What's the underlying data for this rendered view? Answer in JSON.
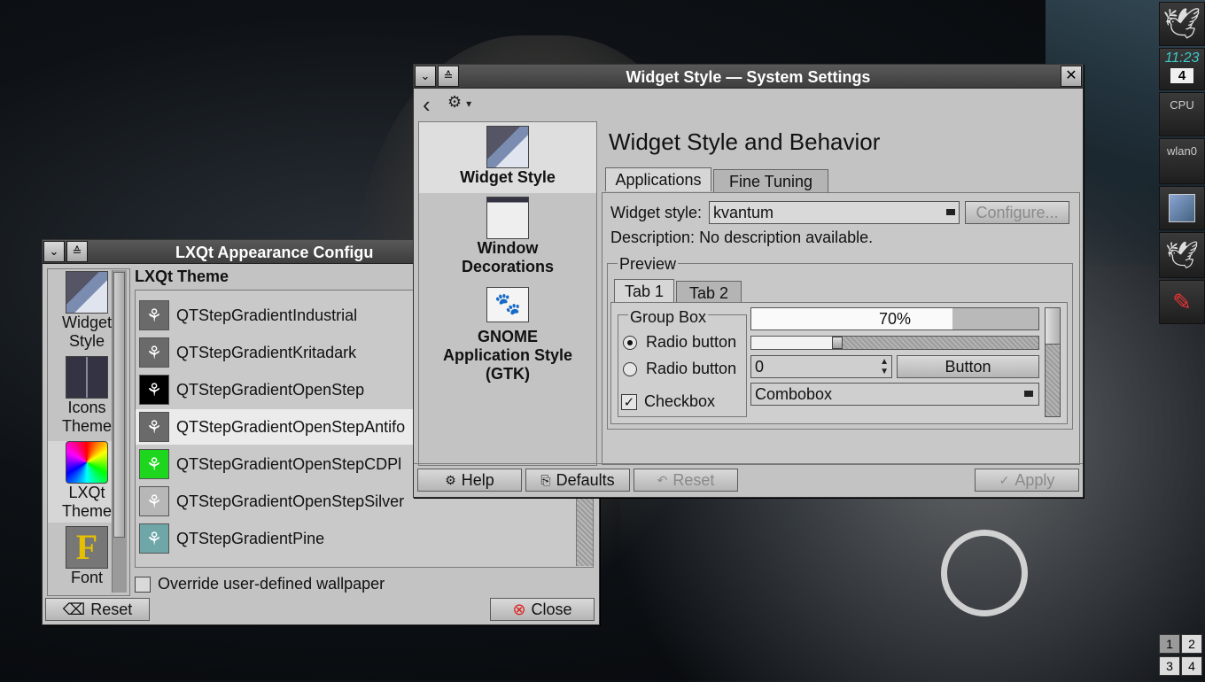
{
  "system_settings": {
    "title": "Widget Style — System Settings",
    "back_glyph": "‹",
    "menu_glyph": "⚙",
    "dropdown_glyph": "▾",
    "categories": [
      {
        "label": "Widget Style",
        "icon": "widget-style-icon"
      },
      {
        "label": "Window Decorations",
        "icon": "window-decorations-icon"
      },
      {
        "label": "GNOME Application Style (GTK)",
        "icon": "gnome-icon"
      }
    ],
    "page_heading": "Widget Style and Behavior",
    "tabs": [
      "Applications",
      "Fine Tuning"
    ],
    "widget_style_label": "Widget style:",
    "widget_style_value": "kvantum",
    "configure_label": "Configure...",
    "description_label": "Description:",
    "description_value": "No description available.",
    "preview": {
      "label": "Preview",
      "tabs": [
        "Tab 1",
        "Tab 2"
      ],
      "group_box": "Group Box",
      "radio1": "Radio button",
      "radio2": "Radio button",
      "checkbox": "Checkbox",
      "progress": 0.7,
      "progress_text": "70%",
      "slider": 0.3,
      "spin_value": "0",
      "button": "Button",
      "combo": "Combobox"
    },
    "footer": {
      "help": "Help",
      "defaults": "Defaults",
      "reset": "Reset",
      "apply": "Apply"
    }
  },
  "lxqt_appearance": {
    "title": "LXQt Appearance Configu",
    "categories": [
      {
        "label": "Widget Style",
        "icon": "widget-style-icon"
      },
      {
        "label": "Icons Theme",
        "icon": "icons-theme-icon"
      },
      {
        "label": "LXQt Theme",
        "icon": "color-wheel-icon"
      },
      {
        "label": "Font",
        "icon": "font-icon"
      }
    ],
    "section_header": "LXQt Theme",
    "themes": [
      {
        "name": "QTStepGradientIndustrial",
        "color": "#6a6a6a"
      },
      {
        "name": "QTStepGradientKritadark",
        "color": "#6a6a6a"
      },
      {
        "name": "QTStepGradientOpenStep",
        "color": "#000000"
      },
      {
        "name": "QTStepGradientOpenStepAntifo",
        "color": "#6a6a6a"
      },
      {
        "name": "QTStepGradientOpenStepCDPl",
        "color": "#1fd61f"
      },
      {
        "name": "QTStepGradientOpenStepSilver",
        "color": "#b7b7b7"
      },
      {
        "name": "QTStepGradientPine",
        "color": "#6fa7a9"
      }
    ],
    "override_label": "Override user-defined wallpaper",
    "reset": "Reset",
    "close": "Close"
  },
  "panel": {
    "clock": "11:23",
    "day": "4",
    "cpu": "CPU",
    "net": "wlan0",
    "desktops": [
      "1",
      "2",
      "3",
      "4"
    ]
  }
}
